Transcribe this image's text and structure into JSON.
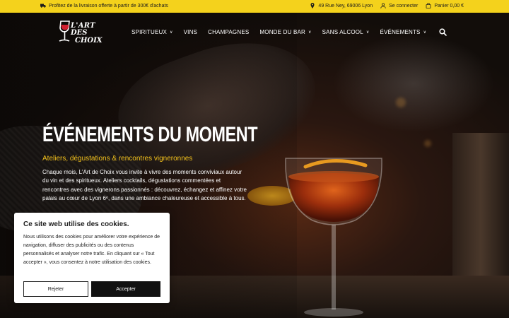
{
  "topbar": {
    "shipping_text": "Profitez de la livraison offerte à partir de 300€ d'achats",
    "address": "49 Rue Ney, 69006 Lyon",
    "login": "Se connecter",
    "cart": "Panier 0,00 €"
  },
  "logo": {
    "line1": "L'ART",
    "line2": "DES",
    "line3": "CHOIX"
  },
  "nav": {
    "items": [
      {
        "label": "SPIRITUEUX",
        "dropdown": true
      },
      {
        "label": "VINS",
        "dropdown": false
      },
      {
        "label": "CHAMPAGNES",
        "dropdown": false
      },
      {
        "label": "MONDE DU BAR",
        "dropdown": true
      },
      {
        "label": "SANS ALCOOL",
        "dropdown": true
      },
      {
        "label": "ÉVÉNEMENTS",
        "dropdown": true
      }
    ]
  },
  "hero": {
    "title": "ÉVÉNEMENTS DU MOMENT",
    "subtitle": "Ateliers, dégustations & rencontres vigneronnes",
    "description": "Chaque mois, L'Art de Choix vous invite à vivre des moments conviviaux autour du vin et des spiritueux. Ateliers cocktails, dégustations commentées et rencontres avec des vignerons passionnés : découvrez, échangez et affinez votre palais au cœur de Lyon 6ᵉ, dans une ambiance chaleureuse et accessible à tous."
  },
  "cookie": {
    "title": "Ce site web utilise des cookies.",
    "text": "Nous utilisons des cookies pour améliorer votre expérience de navigation, diffuser des publicités ou des contenus personnalisés et analyser notre trafic. En cliquant sur « Tout accepter », vous consentez à notre utilisation des cookies.",
    "reject_label": "Rejeter",
    "accept_label": "Accepter"
  },
  "colors": {
    "accent": "#f4d21c",
    "subtitle": "#f4c21c",
    "dark": "#111111"
  }
}
